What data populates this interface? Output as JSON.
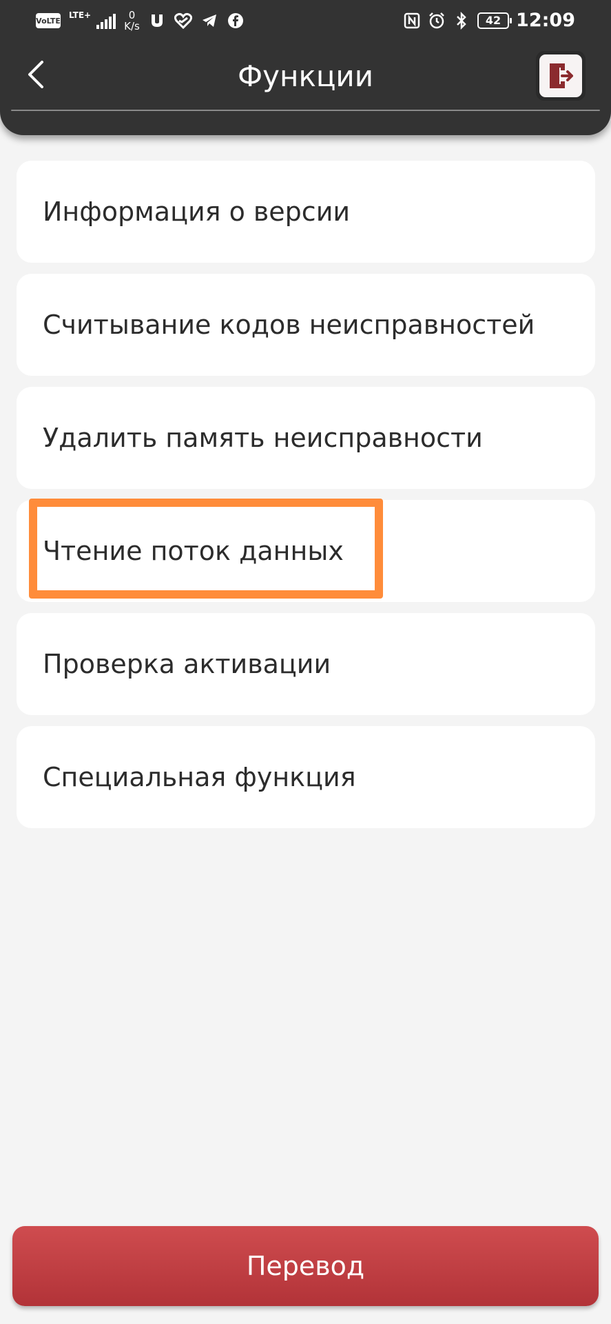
{
  "status_bar": {
    "volte": "VoLTE",
    "lte": "LTE+",
    "speed_value": "0",
    "speed_unit": "K/s",
    "battery": "42",
    "time": "12:09"
  },
  "app_bar": {
    "title": "Функции",
    "back_icon": "chevron-left-icon",
    "exit_icon": "exit-icon"
  },
  "menu": {
    "items": [
      {
        "label": "Информация о версии"
      },
      {
        "label": "Считывание кодов неисправностей"
      },
      {
        "label": "Удалить память неисправности"
      },
      {
        "label": "Чтение поток данных"
      },
      {
        "label": "Проверка активации"
      },
      {
        "label": "Специальная функция"
      }
    ],
    "highlighted_index": 3
  },
  "footer": {
    "button_label": "Перевод"
  },
  "colors": {
    "header_bg": "#333333",
    "button_red": "#c0393e",
    "highlight_orange": "#ff8c3a",
    "exit_icon_red": "#8b2b2e"
  }
}
